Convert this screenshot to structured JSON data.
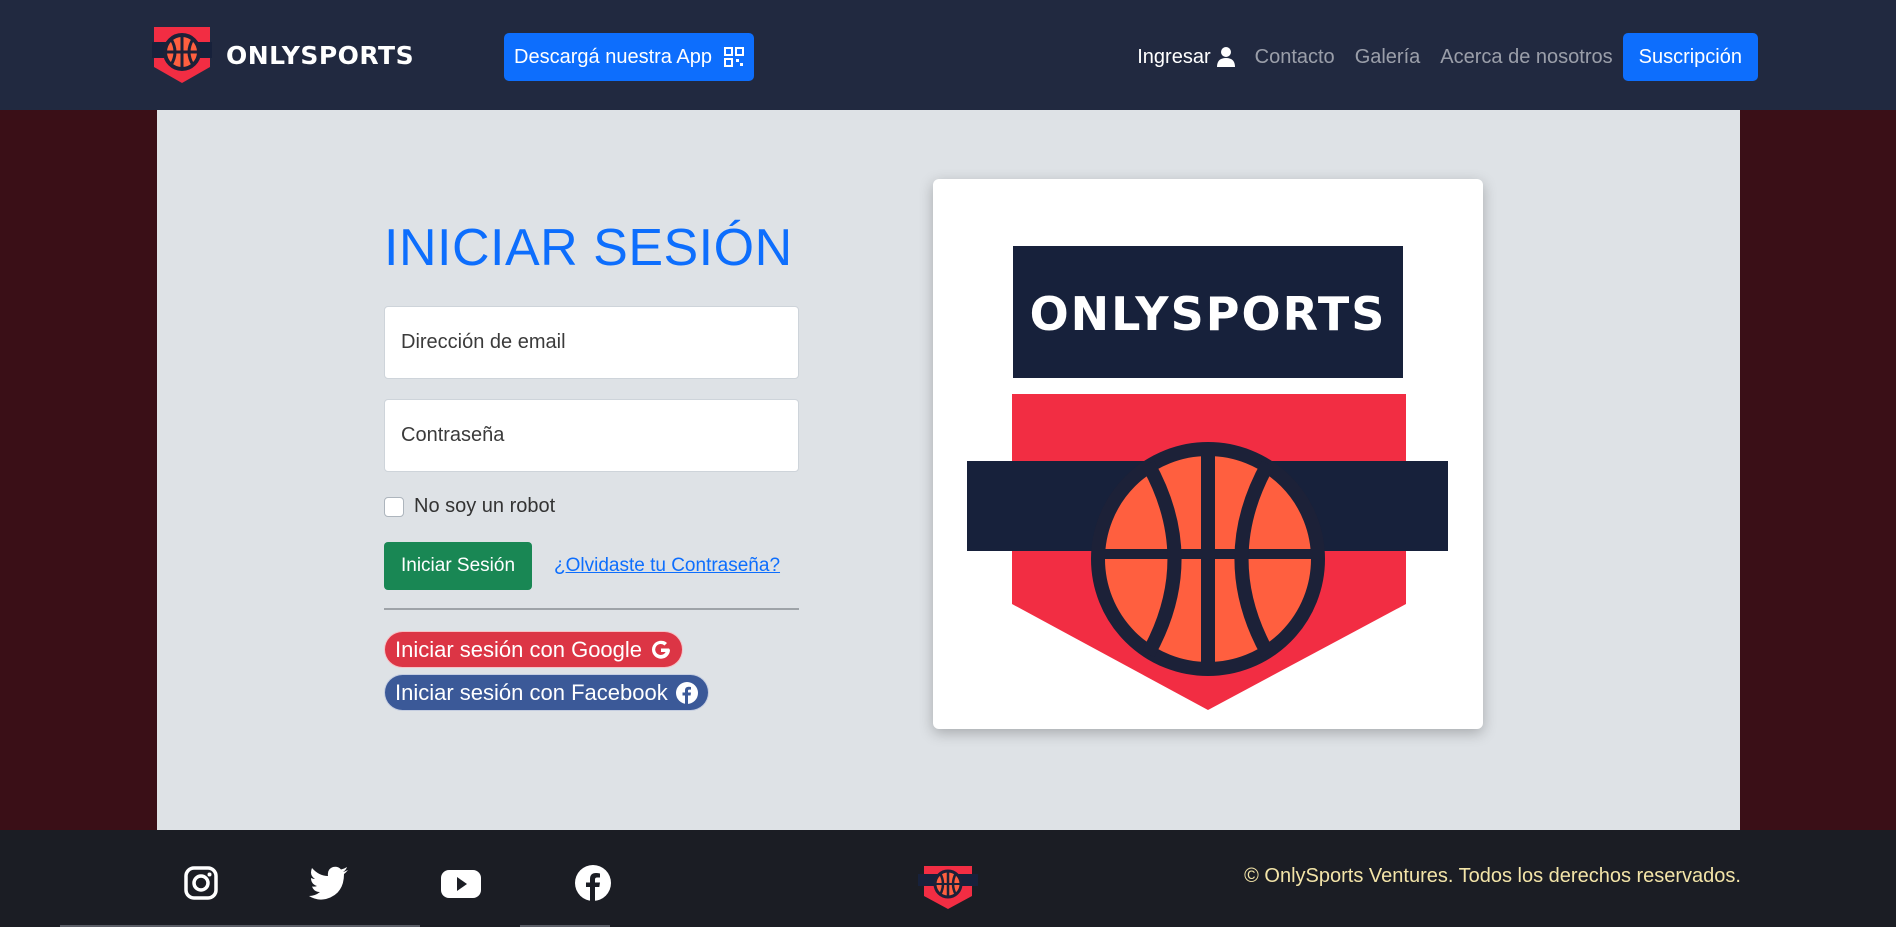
{
  "navbar": {
    "brand": "ONLYSPORTS",
    "app_button": "Descargá nuestra App",
    "links": {
      "login": "Ingresar",
      "contact": "Contacto",
      "gallery": "Galería",
      "about": "Acerca de nosotros"
    },
    "subscribe": "Suscripción"
  },
  "login_form": {
    "title": "INICIAR SESIÓN",
    "email_placeholder": "Dirección de email",
    "password_placeholder": "Contraseña",
    "robot_label": "No soy un robot",
    "submit": "Iniciar Sesión",
    "forgot": "¿Olvidaste tu Contraseña?",
    "google": "Iniciar sesión con Google",
    "facebook": "Iniciar sesión con Facebook"
  },
  "logo_card": {
    "text": "ONLYSPORTS"
  },
  "footer": {
    "copyright": "© OnlySports Ventures. Todos los derechos reservados."
  },
  "colors": {
    "primary": "#0d6efd",
    "success": "#198754",
    "google": "#dc3545",
    "facebook": "#3b5998",
    "navy": "#17213b",
    "red": "#f22d43",
    "ball": "#ff5f3f"
  },
  "icons": [
    "basketball-logo-icon",
    "qr-code-icon",
    "user-icon",
    "google-icon",
    "facebook-icon",
    "instagram-icon",
    "twitter-icon",
    "youtube-icon"
  ]
}
